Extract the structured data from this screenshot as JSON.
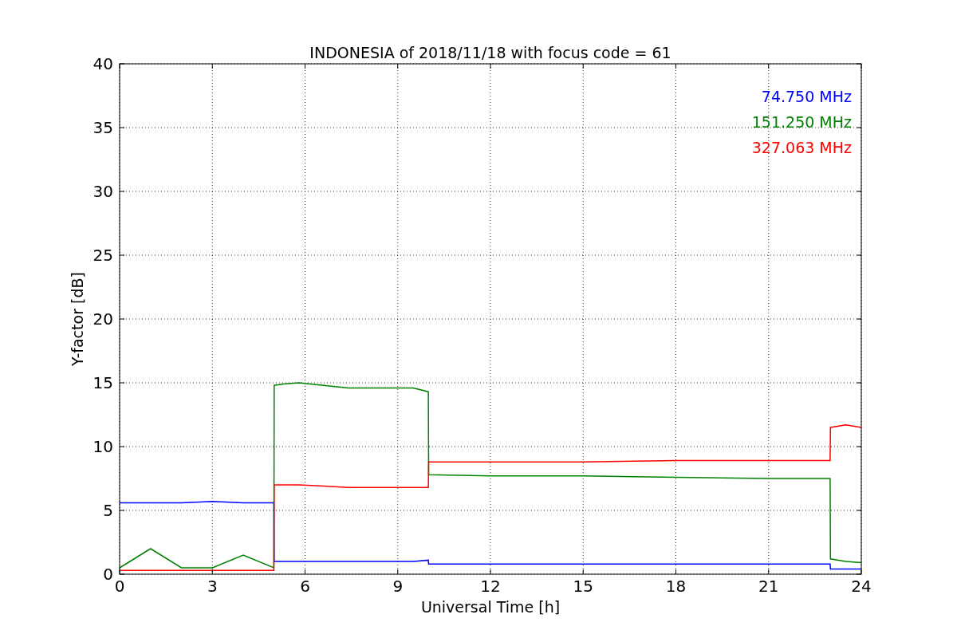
{
  "chart_data": {
    "type": "line",
    "title": "INDONESIA of 2018/11/18 with focus code = 61",
    "xlabel": "Universal Time [h]",
    "ylabel": "Y-factor [dB]",
    "x": [
      0,
      1,
      2,
      3,
      4,
      4.99,
      5,
      5.3,
      5.8,
      6.6,
      7.4,
      8.2,
      9,
      9.5,
      9.99,
      10,
      12,
      15,
      18,
      21,
      22.99,
      23,
      23.5,
      24
    ],
    "series": [
      {
        "name": "74.750 MHz",
        "color": "#0000ff",
        "values": [
          5.6,
          5.6,
          5.6,
          5.7,
          5.6,
          5.6,
          1.0,
          1.0,
          1.0,
          1.0,
          1.0,
          1.0,
          1.0,
          1.0,
          1.1,
          0.8,
          0.8,
          0.8,
          0.8,
          0.8,
          0.8,
          0.4,
          0.4,
          0.4
        ]
      },
      {
        "name": "151.250 MHz",
        "color": "#008000",
        "values": [
          0.5,
          2.0,
          0.5,
          0.5,
          1.5,
          0.5,
          14.8,
          14.9,
          15.0,
          14.8,
          14.6,
          14.6,
          14.6,
          14.6,
          14.3,
          7.8,
          7.7,
          7.7,
          7.6,
          7.5,
          7.5,
          1.2,
          1.0,
          0.9
        ]
      },
      {
        "name": "327.063 MHz",
        "color": "#ff0000",
        "values": [
          0.3,
          0.3,
          0.3,
          0.3,
          0.3,
          0.3,
          7.0,
          7.0,
          7.0,
          6.9,
          6.8,
          6.8,
          6.8,
          6.8,
          6.8,
          8.8,
          8.8,
          8.8,
          8.9,
          8.9,
          8.9,
          11.5,
          11.7,
          11.5
        ]
      }
    ],
    "grid": true,
    "xlim": [
      0,
      24
    ],
    "ylim": [
      0,
      40
    ],
    "xticks": [
      0,
      3,
      6,
      9,
      12,
      15,
      18,
      21,
      24
    ],
    "yticks": [
      0,
      5,
      10,
      15,
      20,
      25,
      30,
      35,
      40
    ]
  }
}
